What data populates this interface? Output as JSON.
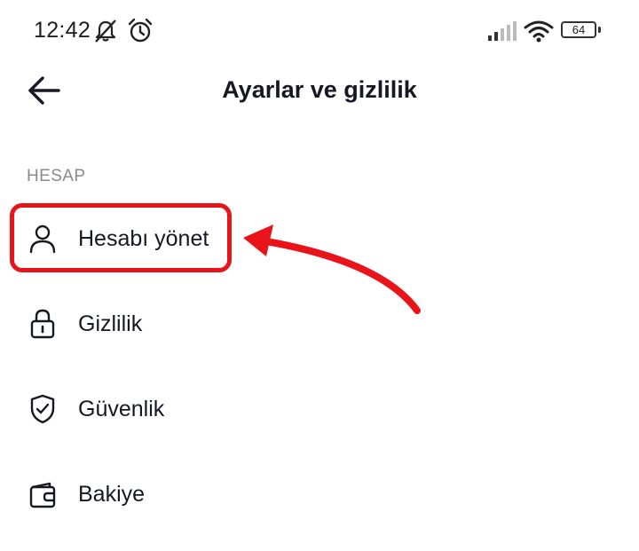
{
  "status_bar": {
    "time": "12:42",
    "battery_level": "64",
    "icons": [
      "mute-icon",
      "alarm-icon",
      "signal-icon",
      "wifi-icon",
      "battery-icon"
    ]
  },
  "header": {
    "title": "Ayarlar ve gizlilik",
    "back_icon": "arrow-left-icon"
  },
  "section": {
    "title": "HESAP",
    "items": [
      {
        "label": "Hesabı yönet",
        "icon": "person-icon",
        "highlighted": true
      },
      {
        "label": "Gizlilik",
        "icon": "lock-icon"
      },
      {
        "label": "Güvenlik",
        "icon": "shield-icon"
      },
      {
        "label": "Bakiye",
        "icon": "wallet-icon"
      }
    ]
  },
  "colors": {
    "annotation": "#e8141a",
    "text_primary": "#161823",
    "text_secondary": "#8a8b91"
  }
}
